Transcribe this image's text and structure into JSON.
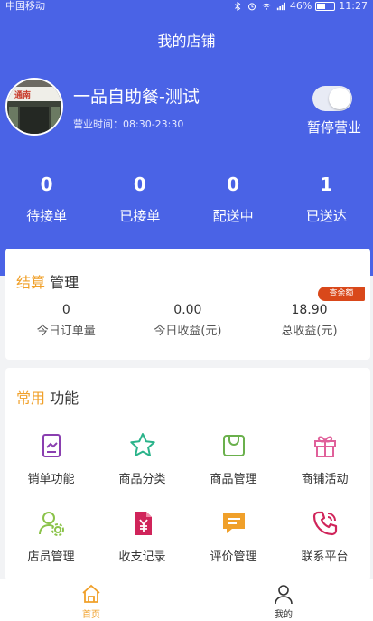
{
  "statusbar": {
    "carrier": "中国移动",
    "battery": "46%",
    "time": "11:27"
  },
  "header": {
    "title": "我的店铺"
  },
  "shop": {
    "name": "一品自助餐-测试",
    "hours": "营业时间：08:30-23:30",
    "toggle_label": "暂停营业",
    "avatar_sign": "通南"
  },
  "stats": [
    {
      "value": "0",
      "label": "待接单"
    },
    {
      "value": "0",
      "label": "已接单"
    },
    {
      "value": "0",
      "label": "配送中"
    },
    {
      "value": "1",
      "label": "已送达"
    }
  ],
  "settle": {
    "title_hl": "结算",
    "title_rest": " 管理",
    "badge": "查余额",
    "items": [
      {
        "value": "0",
        "label": "今日订单量"
      },
      {
        "value": "0.00",
        "label": "今日收益(元)"
      },
      {
        "value": "18.90",
        "label": "总收益(元)"
      }
    ]
  },
  "common": {
    "title_hl": "常用",
    "title_rest": " 功能",
    "items": [
      {
        "label": "销单功能",
        "icon": "receipt-icon",
        "color": "#8a3fb0"
      },
      {
        "label": "商品分类",
        "icon": "star-icon",
        "color": "#2ab38a"
      },
      {
        "label": "商品管理",
        "icon": "bag-icon",
        "color": "#6ab04c"
      },
      {
        "label": "商铺活动",
        "icon": "gift-icon",
        "color": "#e0609a"
      },
      {
        "label": "店员管理",
        "icon": "staff-settings-icon",
        "color": "#8bc34a"
      },
      {
        "label": "收支记录",
        "icon": "ledger-icon",
        "color": "#d0245a"
      },
      {
        "label": "评价管理",
        "icon": "comment-icon",
        "color": "#f0a02a"
      },
      {
        "label": "联系平台",
        "icon": "phone-icon",
        "color": "#d0245a"
      }
    ]
  },
  "tabbar": {
    "home": "首页",
    "me": "我的"
  },
  "colors": {
    "primary": "#4a63e6",
    "accent": "#f0a02a",
    "badge": "#d9481a"
  }
}
